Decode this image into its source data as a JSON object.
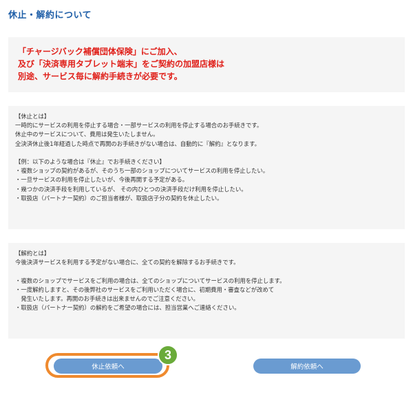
{
  "page": {
    "title": "休止・解約について"
  },
  "notice": {
    "lines": [
      "「チャージバック補償団体保険」にご加入、",
      "及び「決済専用タブレット端末」をご契約の加盟店様は",
      "別途、サービス毎に解約手続きが必要です。"
    ]
  },
  "suspension_info": {
    "lines": [
      "【休止とは】",
      "一時的にサービスの利用を停止する場合・一部サービスの利用を停止する場合のお手続きです。",
      "休止中のサービスについて、費用は発生いたしません。",
      "全決済休止後1年経過した時点で再開のお手続きがない場合は、自動的に『解約』となります。",
      "",
      "【例：以下のような場合は『休止』でお手続きください】",
      "・複数ショップの契約があるが、そのうち一部のショップについてサービスの利用を停止したい。",
      "・一旦サービスの利用を停止したいが、今後再開する予定がある。",
      "・幾つかの決済手段を利用しているが、 その内ひとつの決済手段だけ利用を停止したい。",
      "・取扱店（パートナー契約）のご担当者様が、取扱店子分の契約を休止したい。"
    ]
  },
  "cancellation_info": {
    "lines": [
      "【解約とは】",
      "今後決済サービスを利用する予定がない場合に、全ての契約を解除するお手続きです。",
      "",
      "・複数のショップでサービスをご利用の場合は、全てのショップについてサービスの利用を停止します。",
      "・一度解約しますと、その後弊社のサービスをご利用いただく場合に、初期費用・審査などが改めて",
      "　発生いたします。再開のお手続きは出来ませんのでご注意ください。",
      "・取扱店（パートナー契約）の解約をご希望の場合には、担当営業へご連絡ください。"
    ]
  },
  "buttons": {
    "suspend_label": "休止依頼へ",
    "cancel_label": "解約依頼へ"
  },
  "annotation": {
    "step_number": "3",
    "ring_color": "#ef8a2e",
    "badge_color": "#6aab3a"
  },
  "colors": {
    "accent_blue": "#1f5fa8",
    "button_blue": "#6a9bd1",
    "notice_red": "#e0201a",
    "panel_gray": "#f5f5f5"
  }
}
